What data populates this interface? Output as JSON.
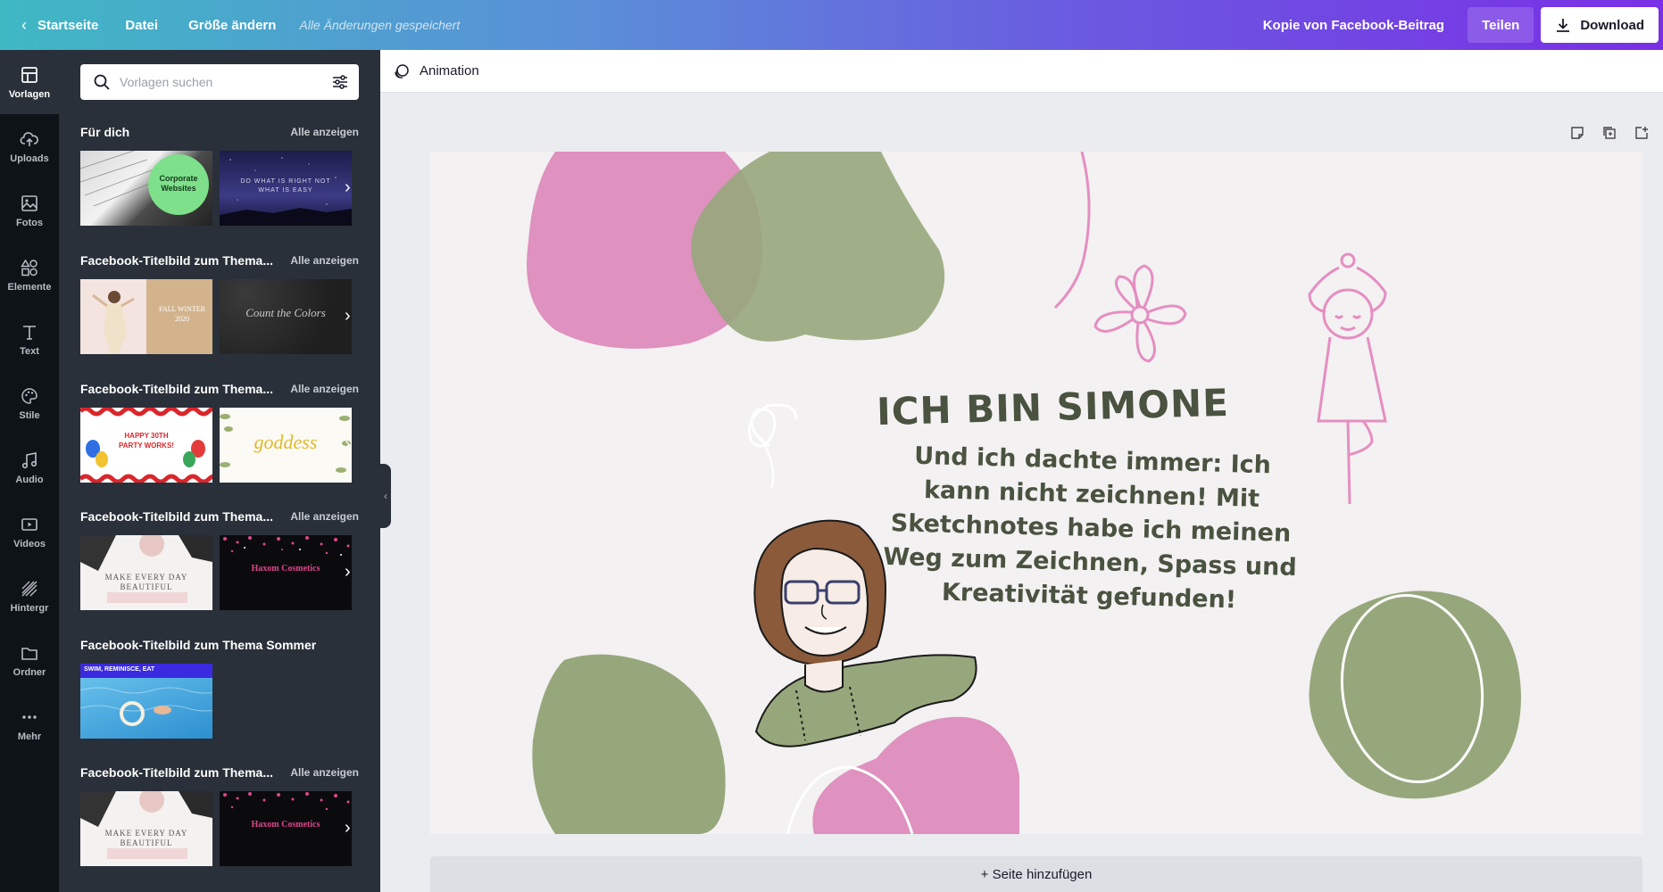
{
  "topbar": {
    "back_label": "Startseite",
    "file_label": "Datei",
    "resize_label": "Größe ändern",
    "saved_status": "Alle Änderungen gespeichert",
    "design_title": "Kopie von Facebook-Beitrag",
    "share_label": "Teilen",
    "download_label": "Download"
  },
  "rail": {
    "items": [
      {
        "label": "Vorlagen",
        "icon": "templates-icon"
      },
      {
        "label": "Uploads",
        "icon": "upload-cloud-icon"
      },
      {
        "label": "Fotos",
        "icon": "image-icon"
      },
      {
        "label": "Elemente",
        "icon": "shapes-icon"
      },
      {
        "label": "Text",
        "icon": "text-icon"
      },
      {
        "label": "Stile",
        "icon": "palette-icon"
      },
      {
        "label": "Audio",
        "icon": "music-note-icon"
      },
      {
        "label": "Videos",
        "icon": "video-icon"
      },
      {
        "label": "Hintergr",
        "icon": "background-hatch-icon"
      },
      {
        "label": "Ordner",
        "icon": "folder-icon"
      },
      {
        "label": "Mehr",
        "icon": "more-dots-icon"
      }
    ]
  },
  "panel": {
    "search_placeholder": "Vorlagen suchen",
    "sections": [
      {
        "title": "Für dich",
        "see_all": "Alle anzeigen",
        "thumb1_text": "Corporate Websites",
        "thumb2_text": "DO WHAT IS RIGHT NOT WHAT IS EASY"
      },
      {
        "title": "Facebook-Titelbild zum Thema...",
        "see_all": "Alle anzeigen",
        "thumb1_text": "FALL WINTER 2020",
        "thumb2_text": "Count the Colors"
      },
      {
        "title": "Facebook-Titelbild zum Thema...",
        "see_all": "Alle anzeigen",
        "thumb1_text": "HAPPY 30TH PARTY WORKS!",
        "thumb2_text": "goddess"
      },
      {
        "title": "Facebook-Titelbild zum Thema...",
        "see_all": "Alle anzeigen",
        "thumb1_text": "MAKE EVERY DAY BEAUTIFUL",
        "thumb2_text": "Haxom Cosmetics"
      },
      {
        "title": "Facebook-Titelbild zum Thema Sommer",
        "see_all": "",
        "thumb1_text": "SWIM, REMINISCE, EAT"
      },
      {
        "title": "Facebook-Titelbild zum Thema...",
        "see_all": "Alle anzeigen",
        "thumb1_text": "MAKE EVERY DAY BEAUTIFUL",
        "thumb2_text": "Haxom Cosmetics"
      }
    ]
  },
  "canvas": {
    "animation_label": "Animation",
    "heading": "ICH BIN SIMONE",
    "body": "Und ich dachte immer: Ich kann nicht zeichnen! Mit Sketchnotes habe ich meinen Weg zum Zeichnen, Spass und Kreativität gefunden!",
    "add_page_label": "+ Seite hinzufügen"
  },
  "colors": {
    "pink": "#df91bf",
    "green": "#97a77c",
    "text": "#4a5240",
    "panel": "#293039",
    "rail": "#0e1318"
  }
}
